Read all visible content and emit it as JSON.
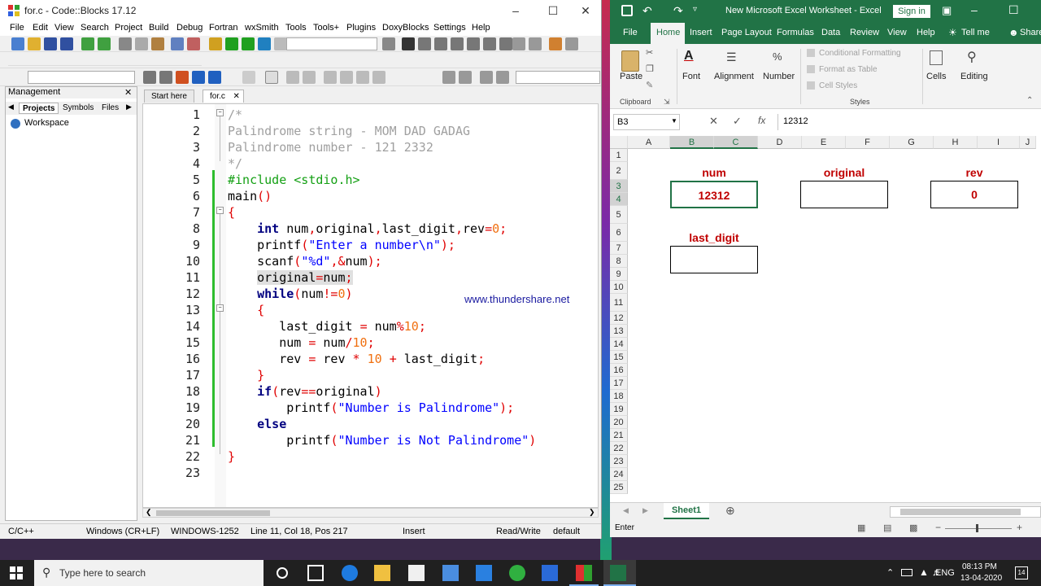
{
  "codeblocks": {
    "window_title": "for.c - Code::Blocks 17.12",
    "menu": [
      "File",
      "Edit",
      "View",
      "Search",
      "Project",
      "Build",
      "Debug",
      "Fortran",
      "wxSmith",
      "Tools",
      "Tools+",
      "Plugins",
      "DoxyBlocks",
      "Settings",
      "Help"
    ],
    "management": {
      "title": "Management",
      "tabs": [
        "Projects",
        "Symbols",
        "Files"
      ],
      "workspace": "Workspace"
    },
    "editor_tabs": [
      "Start here",
      "for.c"
    ],
    "code_lines": [
      {
        "n": "1",
        "t": "/*"
      },
      {
        "n": "2",
        "t": "Palindrome string - MOM DAD GADAG"
      },
      {
        "n": "3",
        "t": "Palindrome number - 121 2332"
      },
      {
        "n": "4",
        "t": "*/"
      },
      {
        "n": "5",
        "t": "#include <stdio.h>"
      },
      {
        "n": "6",
        "t": "main()"
      },
      {
        "n": "7",
        "t": "{"
      },
      {
        "n": "8",
        "t": "    int num,original,last_digit,rev=0;"
      },
      {
        "n": "9",
        "t": "    printf(\"Enter a number\\n\");"
      },
      {
        "n": "10",
        "t": "    scanf(\"%d\",&num);"
      },
      {
        "n": "11",
        "t": "    original=num;"
      },
      {
        "n": "12",
        "t": "    while(num!=0)"
      },
      {
        "n": "13",
        "t": "    {"
      },
      {
        "n": "14",
        "t": "       last_digit = num%10;"
      },
      {
        "n": "15",
        "t": "       num = num/10;"
      },
      {
        "n": "16",
        "t": "       rev = rev * 10 + last_digit;"
      },
      {
        "n": "17",
        "t": "    }"
      },
      {
        "n": "18",
        "t": "    if(rev==original)"
      },
      {
        "n": "19",
        "t": "        printf(\"Number is Palindrome\");"
      },
      {
        "n": "20",
        "t": "    else"
      },
      {
        "n": "21",
        "t": "        printf(\"Number is Not Palindrome\")"
      },
      {
        "n": "22",
        "t": "}"
      },
      {
        "n": "23",
        "t": ""
      }
    ],
    "watermark": "www.thundershare.net",
    "status": {
      "language": "C/C++",
      "line_endings": "Windows (CR+LF)",
      "encoding": "WINDOWS-1252",
      "position": "Line 11, Col 18, Pos 217",
      "mode": "Insert",
      "access": "Read/Write",
      "profile": "default"
    }
  },
  "excel": {
    "window_title": "New Microsoft Excel Worksheet - Excel",
    "sign_in": "Sign in",
    "tabs": [
      "File",
      "Home",
      "Insert",
      "Page Layout",
      "Formulas",
      "Data",
      "Review",
      "View",
      "Help",
      "Tell me",
      "Share"
    ],
    "active_tab": "Home",
    "ribbon": {
      "paste": "Paste",
      "clipboard": "Clipboard",
      "font": "Font",
      "alignment": "Alignment",
      "number": "Number",
      "conditional_formatting": "Conditional Formatting",
      "format_as_table": "Format as Table",
      "cell_styles": "Cell Styles",
      "styles": "Styles",
      "cells": "Cells",
      "editing": "Editing"
    },
    "name_box": "B3",
    "formula": "12312",
    "fx": "fx",
    "columns": [
      "A",
      "B",
      "C",
      "D",
      "E",
      "F",
      "G",
      "H",
      "I",
      "J"
    ],
    "rows": [
      "1",
      "2",
      "3",
      "4",
      "5",
      "6",
      "7",
      "8",
      "9",
      "10",
      "11",
      "12",
      "13",
      "14",
      "15",
      "16",
      "17",
      "18",
      "19",
      "20",
      "21",
      "22",
      "23",
      "24",
      "25"
    ],
    "labels": {
      "num": "num",
      "original": "original",
      "rev": "rev",
      "last_digit": "last_digit"
    },
    "values": {
      "num": "12312",
      "original": "",
      "rev": "0",
      "last_digit": ""
    },
    "sheet_tab": "Sheet1",
    "status_mode": "Enter"
  },
  "taskbar": {
    "search_placeholder": "Type here to search",
    "language": "ENG",
    "time": "08:13 PM",
    "date": "13-04-2020",
    "notifications": "14"
  },
  "colors": {
    "excel_green": "#217346",
    "label_red": "#c00000",
    "taskbar": "#202020"
  }
}
